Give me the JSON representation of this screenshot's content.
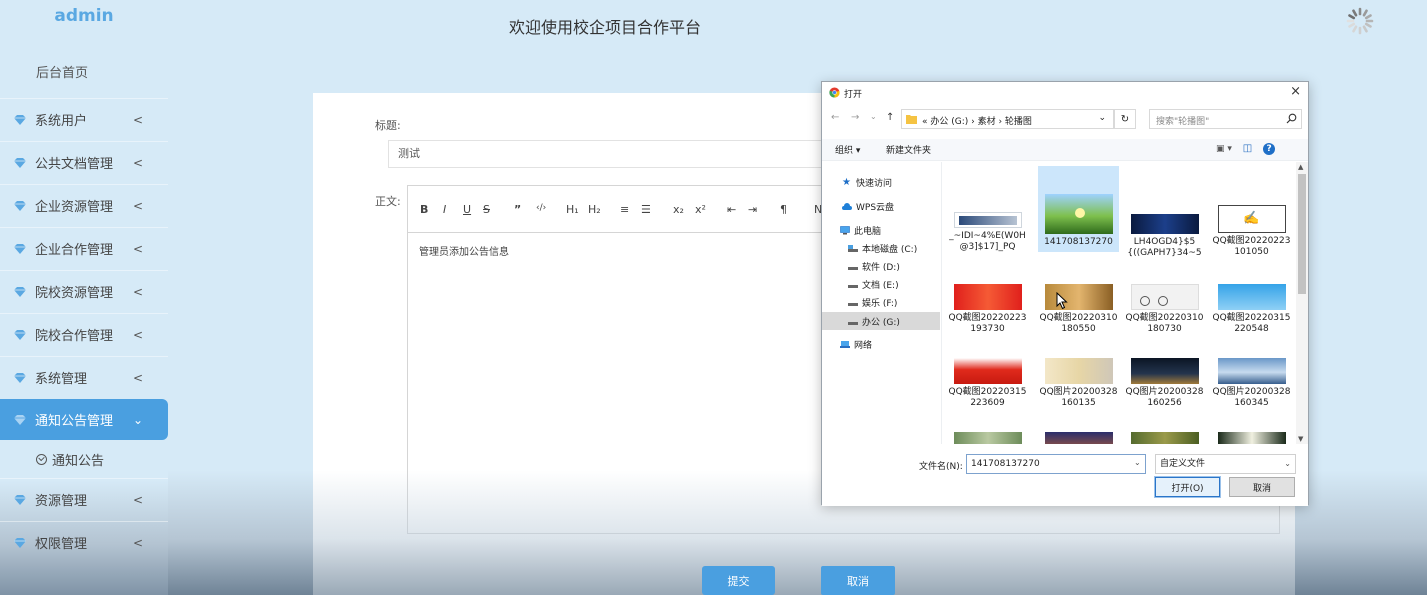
{
  "sidebar": {
    "brand": "admin",
    "home": "后台首页",
    "items": [
      {
        "label": "系统用户",
        "chevron": "<"
      },
      {
        "label": "公共文档管理",
        "chevron": "<"
      },
      {
        "label": "企业资源管理",
        "chevron": "<"
      },
      {
        "label": "企业合作管理",
        "chevron": "<"
      },
      {
        "label": "院校资源管理",
        "chevron": "<"
      },
      {
        "label": "院校合作管理",
        "chevron": "<"
      },
      {
        "label": "系统管理",
        "chevron": "<"
      },
      {
        "label": "通知公告管理",
        "chevron": "⌄"
      },
      {
        "label": "资源管理",
        "chevron": "<"
      },
      {
        "label": "权限管理",
        "chevron": "<"
      }
    ],
    "subitem": "通知公告",
    "colors": {
      "accent": "#4a9fe0",
      "gem": "#5aa8e2"
    }
  },
  "header": {
    "title": "欢迎使用校企项目合作平台"
  },
  "form": {
    "title_label": "标题:",
    "title_value": "测试",
    "body_label": "正文:",
    "toolbar": {
      "bold": "B",
      "italic": "I",
      "underline": "U",
      "strike": "S",
      "quote": "”",
      "code": "‹/›",
      "h1": "H₁",
      "h2": "H₂",
      "ol": "≡",
      "ul": "☰",
      "sub": "x₂",
      "sup": "x²",
      "outdent": "⇤",
      "indent": "⇥",
      "rtl": "¶",
      "normal": "N"
    },
    "body_text": "管理员添加公告信息",
    "submit": "提交",
    "cancel": "取消"
  },
  "dialog": {
    "title": "打开",
    "close": "×",
    "nav": {
      "back": "←",
      "forward": "→",
      "recent": "⌄",
      "up": "↑"
    },
    "address": "« 办公 (G:) › 素材 › 轮播图",
    "refresh": "↻",
    "search_placeholder": "搜索\"轮播图\"",
    "organize": "组织 ▾",
    "new_folder": "新建文件夹",
    "view_toggle": "▣ ▾",
    "pane_toggle": "◫",
    "help": "?",
    "nav_pane": [
      "快速访问",
      "WPS云盘",
      "此电脑",
      "本地磁盘 (C:)",
      "软件 (D:)",
      "文档 (E:)",
      "娱乐 (F:)",
      "办公 (G:)",
      "网络"
    ],
    "files": [
      {
        "name": "_~IDI~4%E(W0H@3]$17]_PQ",
        "thumb": "hct"
      },
      {
        "name": "141708137270",
        "thumb": "sunrise"
      },
      {
        "name": "LH4OGD4}$5{((GAPH7}34~5",
        "thumb": "blue"
      },
      {
        "name": "QQ截图20220223101050",
        "thumb": "calligraphy"
      },
      {
        "name": "QQ截图20220223193730",
        "thumb": "red"
      },
      {
        "name": "QQ截图20220310180550",
        "thumb": "desert"
      },
      {
        "name": "QQ截图20220310180730",
        "thumb": "bikes"
      },
      {
        "name": "QQ截图20220315220548",
        "thumb": "skyblue"
      },
      {
        "name": "QQ截图20220315223609",
        "thumb": "redgift"
      },
      {
        "name": "QQ图片20200328160135",
        "thumb": "calli2"
      },
      {
        "name": "QQ图片20200328160256",
        "thumb": "night"
      },
      {
        "name": "QQ图片20200328160345",
        "thumb": "bridge"
      },
      {
        "name": "",
        "thumb": "green"
      },
      {
        "name": "",
        "thumb": "sunset"
      },
      {
        "name": "",
        "thumb": "olive"
      },
      {
        "name": "",
        "thumb": "flower"
      }
    ],
    "filename_label": "文件名(N):",
    "filename_value": "141708137270",
    "filetype": "自定义文件",
    "open_btn": "打开(O)",
    "cancel_btn": "取消"
  }
}
